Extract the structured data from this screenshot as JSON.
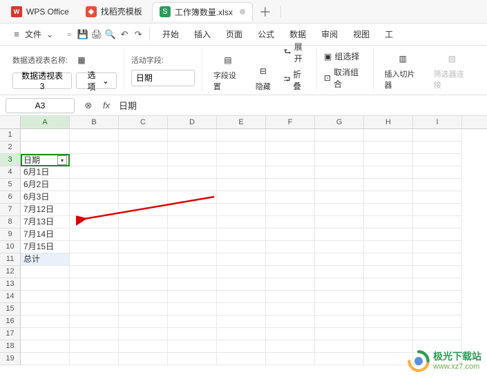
{
  "tabs": {
    "wps": "WPS Office",
    "template": "找稻壳模板",
    "workbook": "工作簿数量.xlsx"
  },
  "menu": {
    "file": "文件",
    "start": "开始",
    "insert": "插入",
    "page": "页面",
    "formula": "公式",
    "data": "数据",
    "review": "审阅",
    "view": "视图",
    "tool": "工"
  },
  "ribbon": {
    "pivot_name_label": "数据透视表名称:",
    "pivot_name_btn": "数据透视表3",
    "options_btn": "选项",
    "active_field_label": "活动字段:",
    "active_field_value": "日期",
    "field_settings": "字段设置",
    "hide": "隐藏",
    "expand": "展开",
    "collapse": "折叠",
    "group_select": "组选择",
    "ungroup": "取消组合",
    "insert_slicer": "插入切片器",
    "filter_conn": "筛选器连接"
  },
  "formula_bar": {
    "name_box": "A3",
    "formula": "日期"
  },
  "columns": [
    "A",
    "B",
    "C",
    "D",
    "E",
    "F",
    "G",
    "H",
    "I"
  ],
  "rows": [
    1,
    2,
    3,
    4,
    5,
    6,
    7,
    8,
    9,
    10,
    11,
    12,
    13,
    14,
    15,
    16,
    17,
    18,
    19
  ],
  "pivot": {
    "header": "日期",
    "data": [
      "6月1日",
      "6月2日",
      "6月3日",
      "7月12日",
      "7月13日",
      "7月14日",
      "7月15日"
    ],
    "total": "总计"
  },
  "watermark": {
    "cn": "极光下载站",
    "url": "www.xz7.com"
  }
}
